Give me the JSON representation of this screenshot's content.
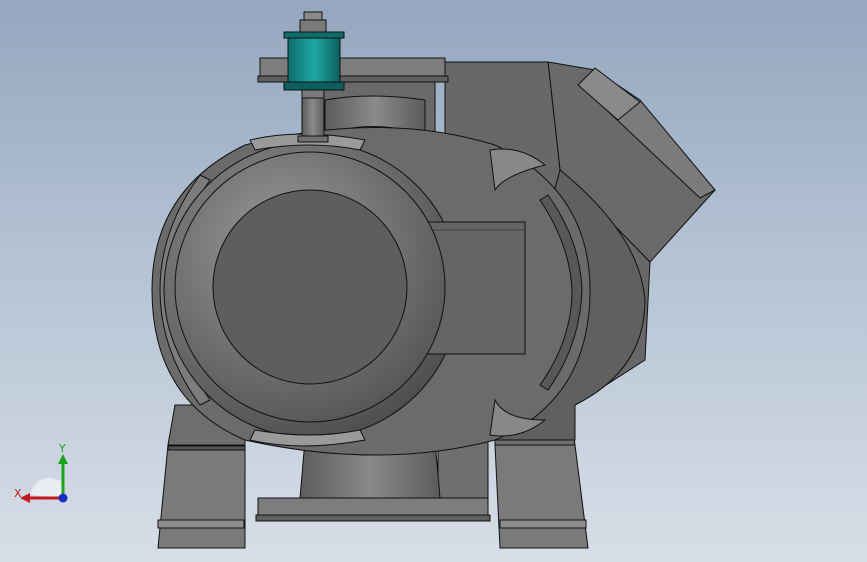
{
  "viewport": {
    "background_top": "#94a7bf",
    "background_bottom": "#d7dee7"
  },
  "model": {
    "body_color": "#6b6b6b",
    "shade_color": "#5a5a5a",
    "light_color": "#8a8a8a",
    "edge_color": "#111111",
    "accent_part_color": "#158a88"
  },
  "triad": {
    "x_label": "X",
    "y_label": "Y",
    "x_color": "#c21a1a",
    "y_color": "#1aa31a",
    "z_color": "#1a2ec2"
  }
}
